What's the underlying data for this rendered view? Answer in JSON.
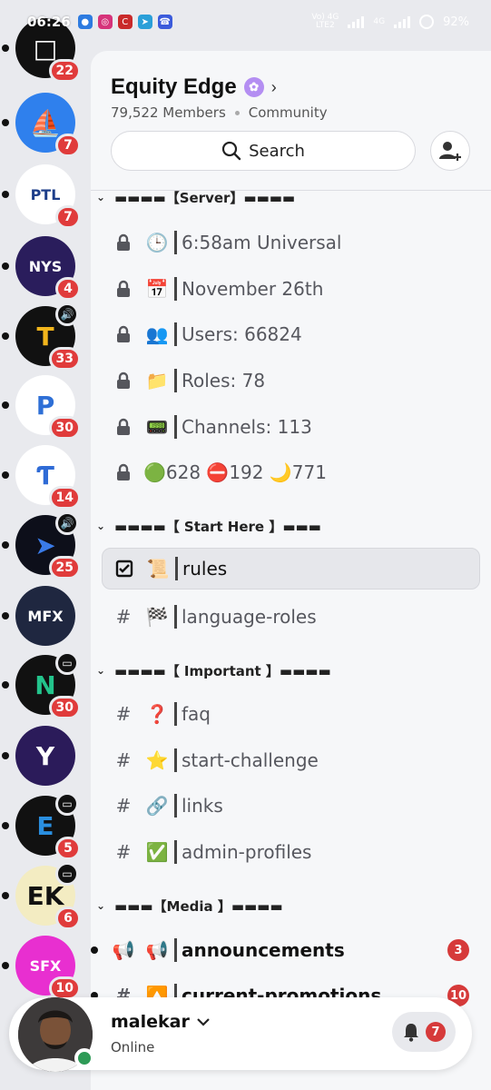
{
  "status_bar": {
    "time": "06:26",
    "network_top": "Vo) 4G",
    "network_bottom": "LTE2",
    "network2": "4G",
    "battery": "92%"
  },
  "servers": [
    {
      "name": "server-1",
      "badge": "22",
      "bg": "#111111",
      "fg": "#ffffff",
      "glyph": "□"
    },
    {
      "name": "opensea",
      "badge": "7",
      "bg": "#2f80ed",
      "fg": "#ffffff",
      "glyph": "⛵"
    },
    {
      "name": "ptl",
      "badge": "7",
      "bg": "#ffffff",
      "fg": "#1d3e8a",
      "glyph": "PTL"
    },
    {
      "name": "nys",
      "badge": "4",
      "bg": "#2a1d5c",
      "fg": "#ffffff",
      "glyph": "NYS"
    },
    {
      "name": "tradlyx",
      "badge": "33",
      "bg": "#111111",
      "fg": "#f2b51c",
      "glyph": "T"
    },
    {
      "name": "proffinest",
      "badge": "30",
      "bg": "#ffffff",
      "fg": "#2e6fd6",
      "glyph": "P"
    },
    {
      "name": "ts-server",
      "badge": "14",
      "bg": "#ffffff",
      "fg": "#2f6bd6",
      "glyph": "Ƭ"
    },
    {
      "name": "arrow-server",
      "badge": "25",
      "bg": "#0d0f1a",
      "fg": "#3a7be8",
      "glyph": "➤"
    },
    {
      "name": "mfx",
      "badge": "",
      "bg": "#1f2740",
      "fg": "#ffffff",
      "glyph": "MFX"
    },
    {
      "name": "n-server",
      "badge": "30",
      "bg": "#111111",
      "fg": "#23c48c",
      "glyph": "N"
    },
    {
      "name": "y-server",
      "badge": "",
      "bg": "#2b1b5a",
      "fg": "#ffffff",
      "glyph": "Y"
    },
    {
      "name": "e-server",
      "badge": "5",
      "bg": "#111111",
      "fg": "#2a8fe0",
      "glyph": "E"
    },
    {
      "name": "ek-server",
      "badge": "6",
      "bg": "#f3ecc2",
      "fg": "#111111",
      "glyph": "EK"
    },
    {
      "name": "sfx-funded",
      "badge": "10",
      "bg": "#e82fd0",
      "fg": "#ffffff",
      "glyph": "SFX"
    }
  ],
  "server": {
    "name": "Equity Edge",
    "members": "79,522 Members",
    "type": "Community"
  },
  "search": {
    "label": "Search"
  },
  "categories": {
    "server": "▬▬▬▬【Server】▬▬▬▬",
    "start_here": "▬▬▬▬【 Start Here 】▬▬▬",
    "important": "▬▬▬▬【 Important 】▬▬▬▬",
    "media": "▬▬▬【Media 】▬▬▬▬"
  },
  "stat_channels": [
    {
      "emoji": "🕒",
      "name": "6:58am Universal"
    },
    {
      "emoji": "📅",
      "name": "November 26th"
    },
    {
      "emoji": "👥",
      "name": "Users: 66824"
    },
    {
      "emoji": "📁",
      "name": "Roles: 78"
    },
    {
      "emoji": "📟",
      "name": "Channels: 113"
    },
    {
      "emoji": "",
      "name": "🟢628 ⛔192 🌙771"
    }
  ],
  "start_channels": [
    {
      "emoji": "📜",
      "name": "rules"
    },
    {
      "emoji": "🏁",
      "name": "language-roles"
    }
  ],
  "important_channels": [
    {
      "emoji": "❓",
      "name": "faq"
    },
    {
      "emoji": "⭐",
      "name": "start-challenge"
    },
    {
      "emoji": "🔗",
      "name": "links"
    },
    {
      "emoji": "✅",
      "name": "admin-profiles"
    }
  ],
  "media_channels": [
    {
      "emoji": "📢",
      "name": "announcements",
      "badge": "3"
    },
    {
      "emoji": "🔼",
      "name": "current-promotions",
      "badge": "10"
    }
  ],
  "user": {
    "name": "malekar",
    "status": "Online",
    "notifications": "7"
  },
  "colors": {
    "accent_red": "#d63a3a",
    "online_green": "#2e9b57",
    "boost_purple": "#b48ef2"
  }
}
